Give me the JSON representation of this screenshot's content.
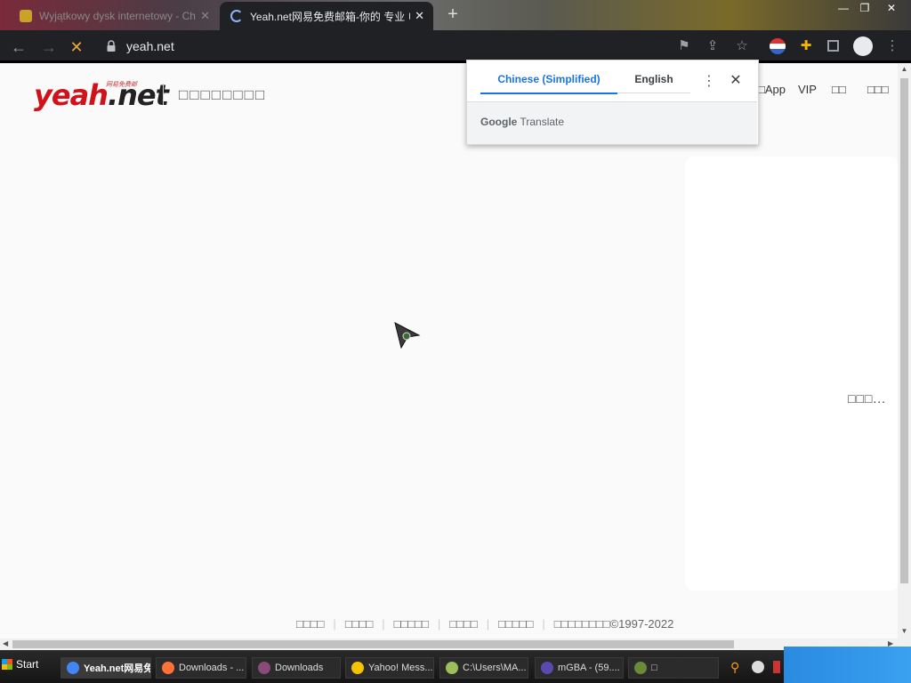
{
  "browser": {
    "tabs": [
      {
        "label": "Wyjątkowy dysk internetowy - Ch",
        "active": false
      },
      {
        "label": "Yeah.net网易免费邮箱-你的 专业 电子",
        "active": true
      }
    ],
    "url": "yeah.net",
    "new_tab_symbol": "+"
  },
  "page": {
    "logo_text_1": "yeah",
    "logo_text_2": ".net",
    "logo_tagline": "网易免费邮",
    "logo_subtitle": "□□□□□□□□",
    "nav": [
      "□App",
      "VIP",
      "□□",
      "□□□"
    ],
    "loading_text": "□□□...",
    "footer": [
      "□□□□",
      "□□□□",
      "□□□□□",
      "□□□□",
      "□□□□□",
      "□□□□□□□□©1997-2022"
    ]
  },
  "translate_popup": {
    "source_language": "Chinese (Simplified)",
    "target_language": "English",
    "brand_google": "Google",
    "brand_translate": "Translate"
  },
  "taskbar": {
    "start_label": "Start",
    "items": [
      {
        "label": "Yeah.net网易免费邮",
        "icon": "chrome-icon",
        "color": "#4285f4",
        "active": true
      },
      {
        "label": "Downloads - ...",
        "icon": "firefox-icon",
        "color": "#ff7139",
        "active": false
      },
      {
        "label": "Downloads",
        "icon": "folder-icon",
        "color": "#8a4a7a",
        "active": false
      },
      {
        "label": "Yahoo! Mess...",
        "icon": "yahoo-messenger-icon",
        "color": "#f5c400",
        "active": false
      },
      {
        "label": "C:\\Users\\MA...",
        "icon": "notepad-icon",
        "color": "#9bbf5a",
        "active": false
      },
      {
        "label": "mGBA - (59....",
        "icon": "mgba-icon",
        "color": "#5a4ab0",
        "active": false
      },
      {
        "label": "□",
        "icon": "app-icon",
        "color": "#6a8a3a",
        "active": false
      }
    ]
  }
}
